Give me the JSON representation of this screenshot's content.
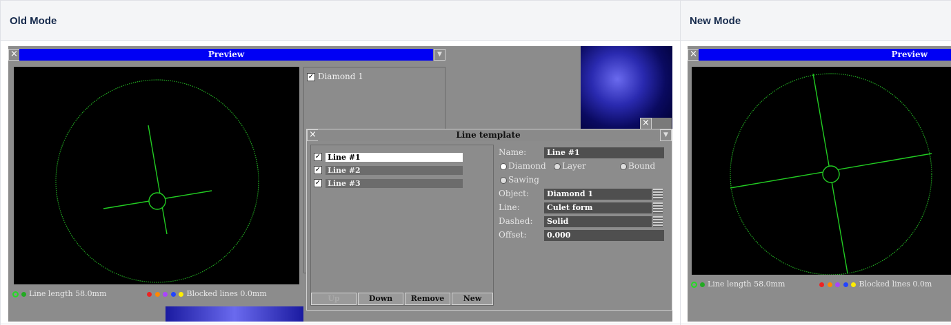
{
  "table": {
    "col1_header": "Old Mode",
    "col2_header": "New Mode"
  },
  "old_mode": {
    "preview": {
      "title": "Preview",
      "status_line_length": "Line length 58.0mm",
      "status_blocked": "Blocked lines 0.0mm"
    },
    "object_list": {
      "items": [
        "Diamond 1"
      ]
    },
    "line_template": {
      "title": "Line template",
      "lines": [
        "Line #1",
        "Line #2",
        "Line #3"
      ],
      "name_label": "Name:",
      "name_value": "Line #1",
      "radio_options": [
        "Diamond",
        "Layer",
        "Bound",
        "Sawing"
      ],
      "selected_radio": "Diamond",
      "object_label": "Object:",
      "object_value": "Diamond 1",
      "line_label": "Line:",
      "line_value": "Culet form",
      "dashed_label": "Dashed:",
      "dashed_value": "Solid",
      "offset_label": "Offset:",
      "offset_value": "0.000",
      "buttons": {
        "up": "Up",
        "down": "Down",
        "remove": "Remove",
        "new": "New"
      }
    }
  },
  "new_mode": {
    "preview": {
      "title": "Preview",
      "status_line_length": "Line length 58.0mm",
      "status_blocked": "Blocked lines 0.0m"
    }
  },
  "colors": {
    "titlebar": "#0000f4",
    "line_green": "#22cc22",
    "dot_colors": [
      "#ee2222",
      "#ff8800",
      "#aa44ff",
      "#2244ff",
      "#ffee00"
    ]
  }
}
